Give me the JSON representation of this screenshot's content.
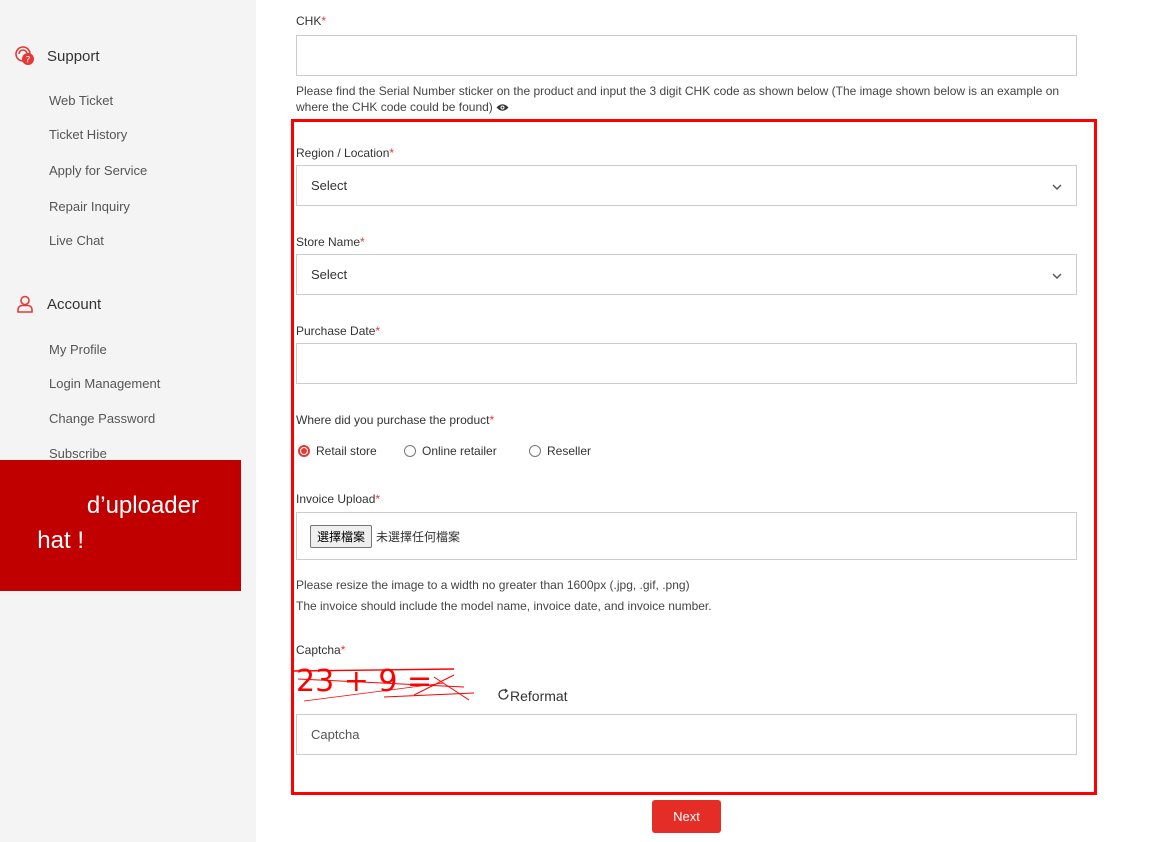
{
  "sidebar": {
    "support": {
      "title": "Support",
      "items": [
        "Web Ticket",
        "Ticket History",
        "Apply for Service",
        "Repair Inquiry",
        "Live Chat"
      ]
    },
    "account": {
      "title": "Account",
      "items": [
        "My Profile",
        "Login Management",
        "Change Password",
        "Subscribe"
      ]
    }
  },
  "overlay": {
    "line1": "d’uploader",
    "line2": "hat !"
  },
  "form": {
    "chk": {
      "label": "CHK",
      "value": "",
      "hint": "Please find the Serial Number sticker on the product and input the 3 digit CHK code as shown below (The image shown below is an example on where the CHK code could be found)"
    },
    "region": {
      "label": "Region / Location",
      "value": "Select"
    },
    "store": {
      "label": "Store Name",
      "value": "Select"
    },
    "purchase_date": {
      "label": "Purchase Date",
      "value": ""
    },
    "purchase_where": {
      "label": "Where did you purchase the product",
      "options": [
        "Retail store",
        "Online retailer",
        "Reseller"
      ],
      "selected": "Retail store"
    },
    "invoice": {
      "label": "Invoice Upload",
      "button": "選擇檔案",
      "status": "未選擇任何檔案",
      "hint1": "Please resize the image to a width no greater than 1600px (.jpg, .gif, .png)",
      "hint2": "The invoice should include the model name, invoice date, and invoice number."
    },
    "captcha": {
      "label": "Captcha",
      "image_text": "23 + 9 =",
      "reformat": "Reformat",
      "placeholder": "Captcha"
    },
    "required_mark": "*",
    "next": "Next"
  },
  "colors": {
    "accent": "#e52d27",
    "highlight": "#ff0000",
    "overlay": "#c00000"
  }
}
